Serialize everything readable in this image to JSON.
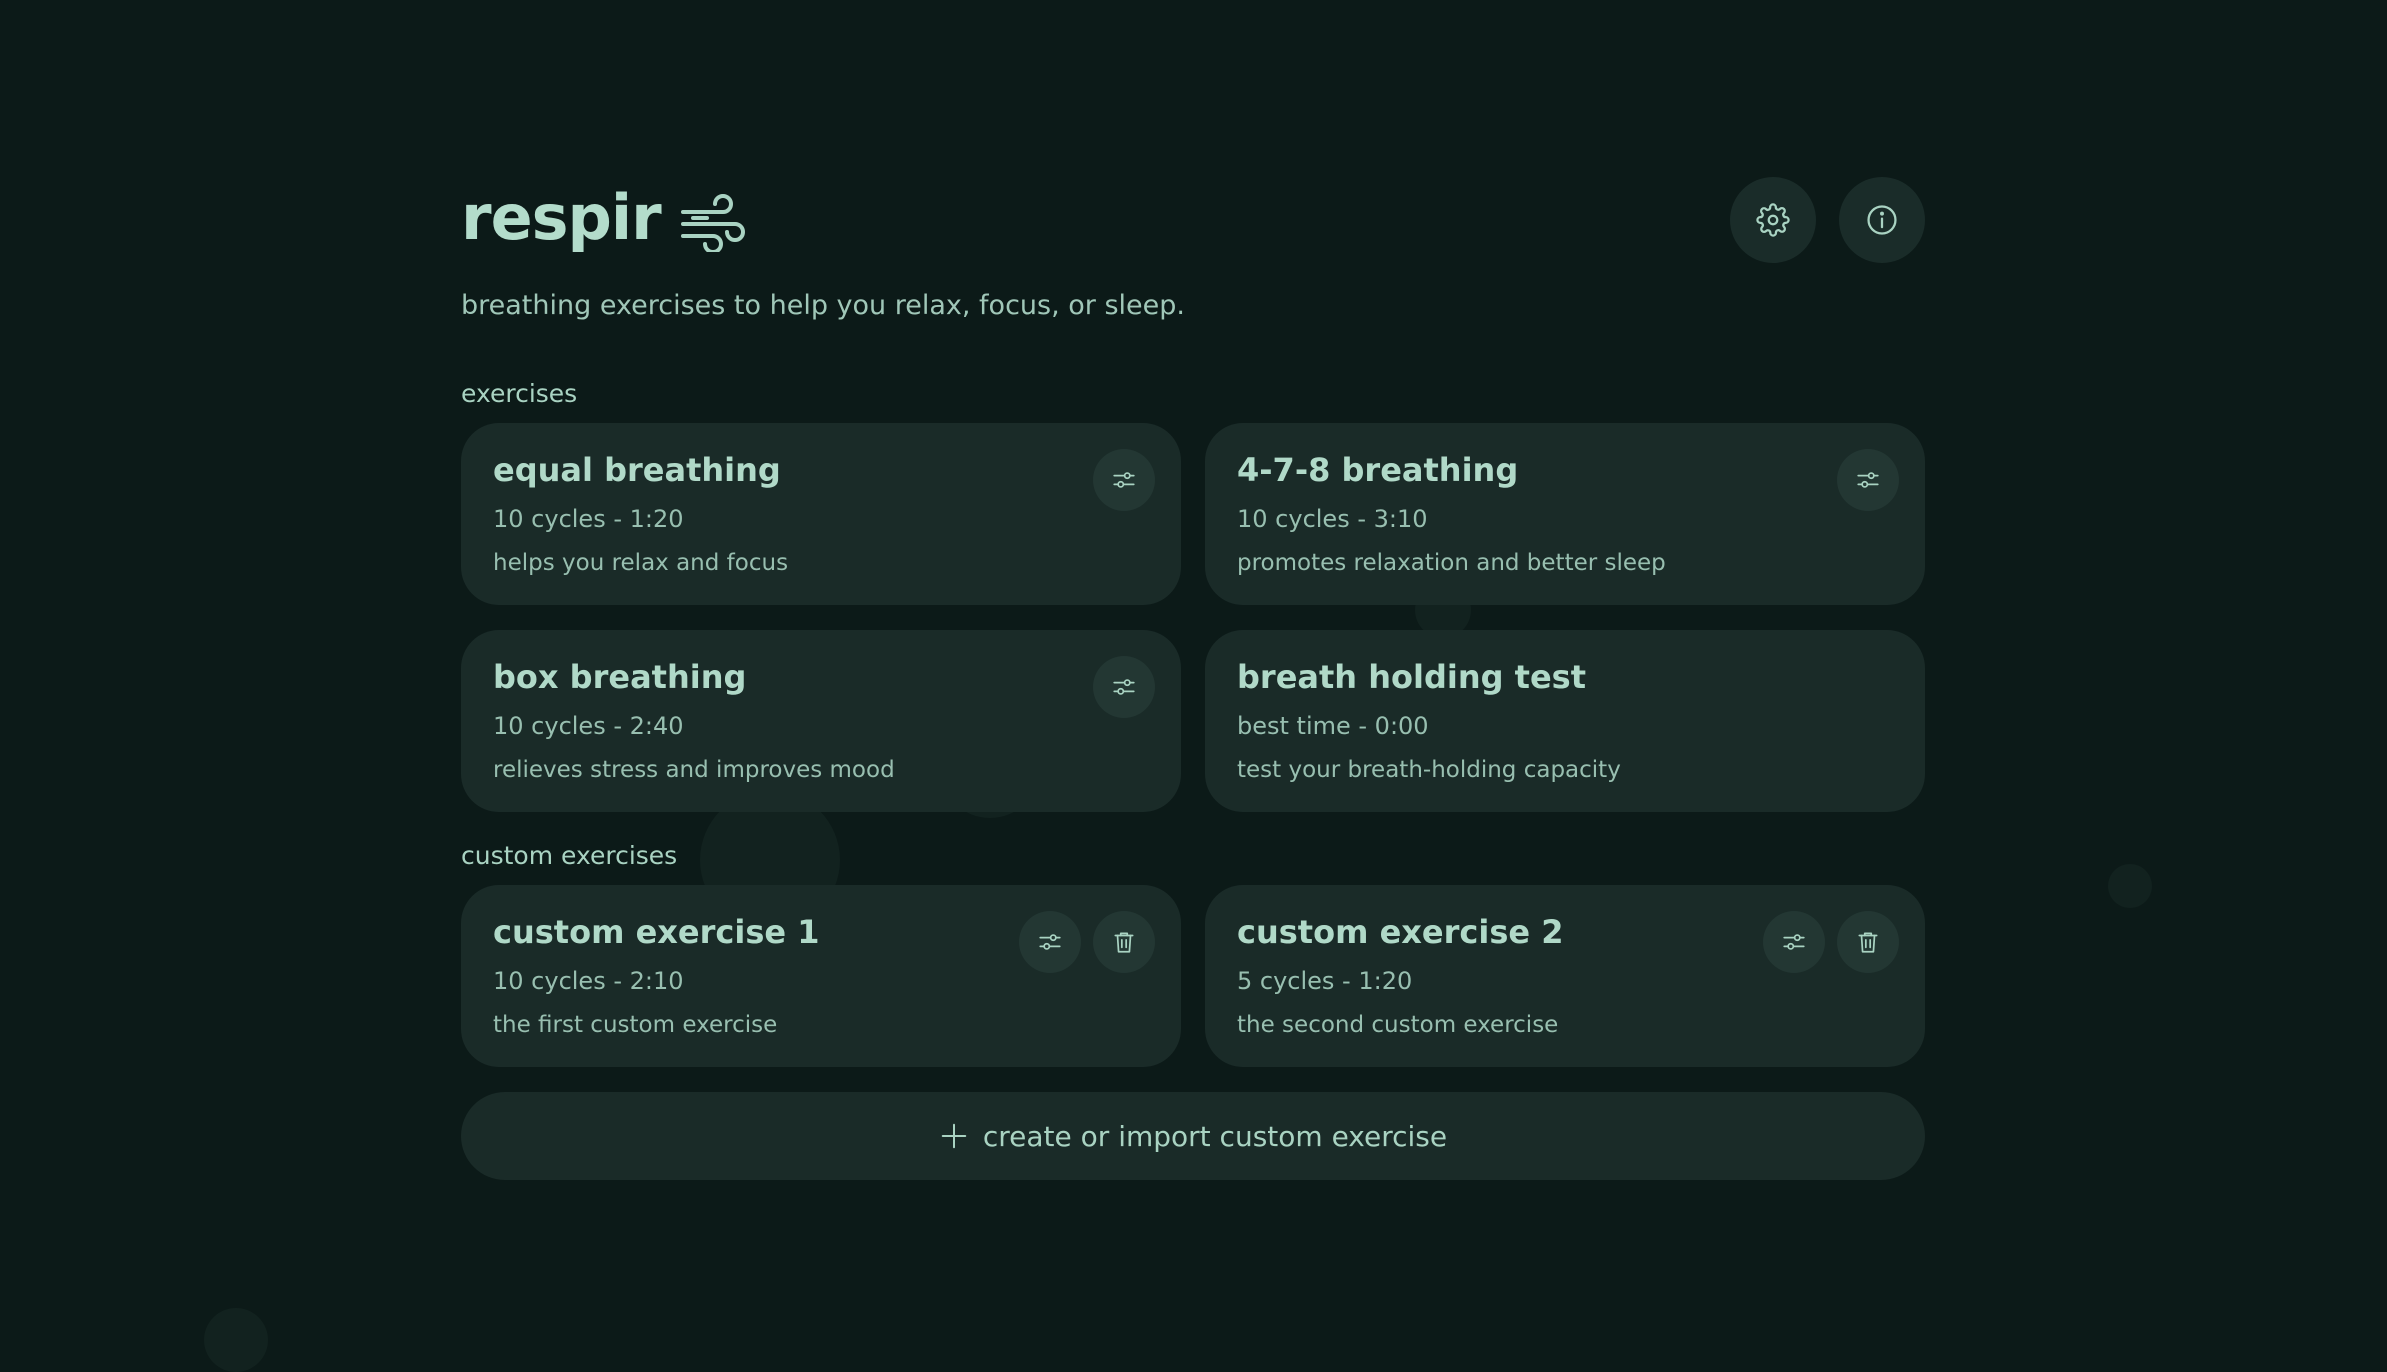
{
  "app": {
    "title": "respir",
    "subtitle": "breathing exercises to help you relax, focus, or sleep.",
    "logo_icon": "wind-icon"
  },
  "header": {
    "settings_icon": "gear-icon",
    "info_icon": "info-icon"
  },
  "sections": {
    "exercises_label": "exercises",
    "custom_label": "custom exercises"
  },
  "exercises": [
    {
      "title": "equal breathing",
      "meta": "10 cycles - 1:20",
      "desc": "helps you relax and focus"
    },
    {
      "title": "4-7-8 breathing",
      "meta": "10 cycles - 3:10",
      "desc": "promotes relaxation and better sleep"
    },
    {
      "title": "box breathing",
      "meta": "10 cycles - 2:40",
      "desc": "relieves stress and improves mood"
    },
    {
      "title": "breath holding test",
      "meta": "best time - 0:00",
      "desc": "test your breath-holding capacity"
    }
  ],
  "custom_exercises": [
    {
      "title": "custom exercise 1",
      "meta": "10 cycles - 2:10",
      "desc": "the first custom exercise"
    },
    {
      "title": "custom exercise 2",
      "meta": "5 cycles - 1:20",
      "desc": "the second custom exercise"
    }
  ],
  "create_button": {
    "label": "create or import custom exercise",
    "icon": "plus-icon"
  },
  "colors": {
    "background": "#0c1a18",
    "card": "#1a2b28",
    "text": "#a9d3c2"
  }
}
